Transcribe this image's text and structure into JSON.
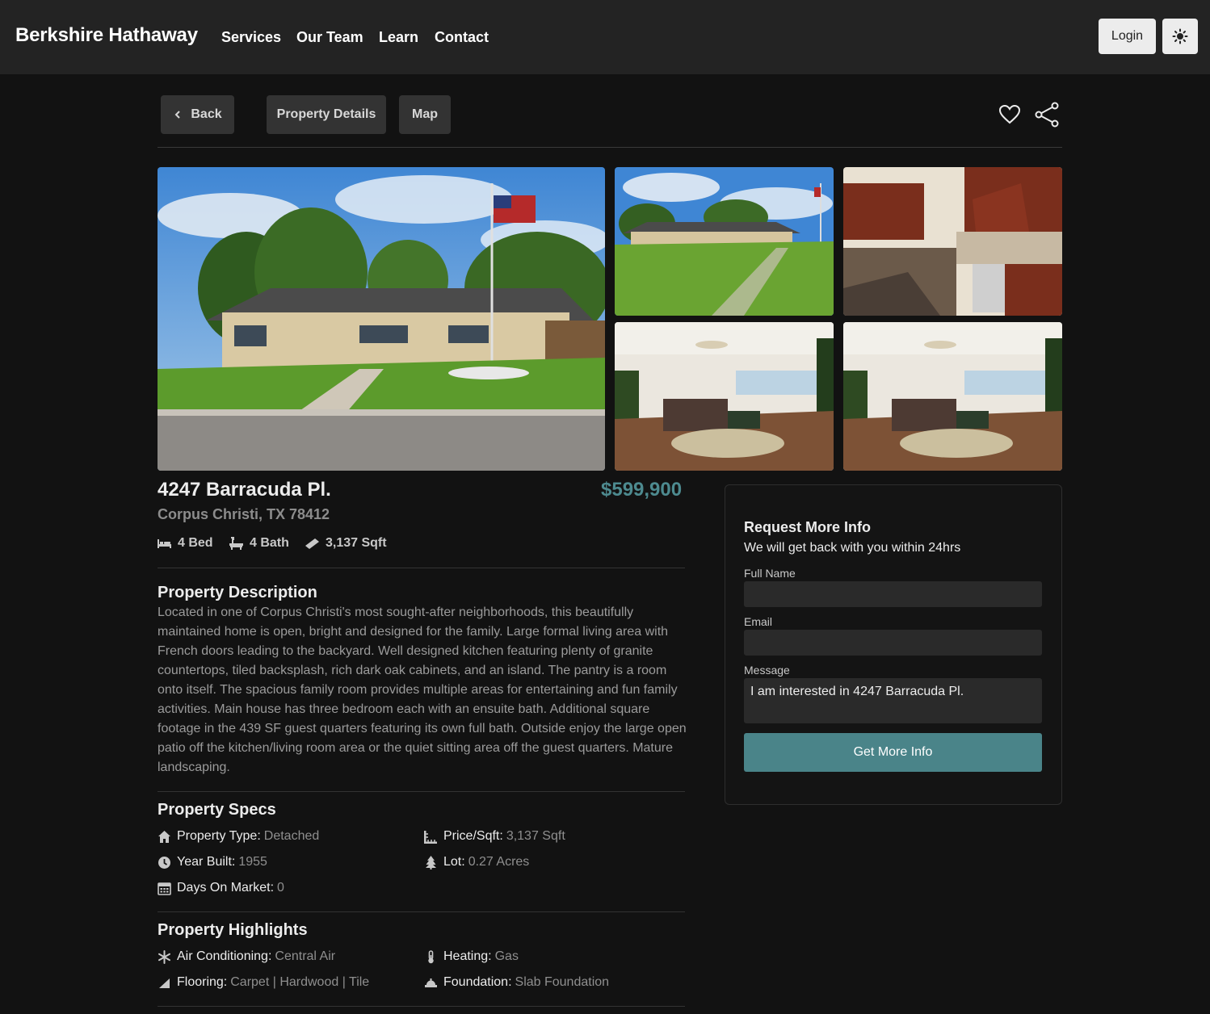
{
  "header": {
    "brand": "Berkshire Hathaway",
    "nav": [
      "Services",
      "Our Team",
      "Learn",
      "Contact"
    ],
    "login_label": "Login"
  },
  "actions": {
    "back_label": "Back",
    "details_label": "Property Details",
    "map_label": "Map"
  },
  "gallery": [
    "exterior-front",
    "exterior-lawn",
    "kitchen",
    "living-room",
    "living-room"
  ],
  "listing": {
    "address": "4247 Barracuda Pl.",
    "city": "Corpus Christi, TX 78412",
    "price": "$599,900",
    "beds": "4 Bed",
    "baths": "4 Bath",
    "sqft": "3,137 Sqft"
  },
  "description": {
    "title": "Property Description",
    "text": "Located in one of Corpus Christi's most sought-after neighborhoods, this beautifully maintained home is open, bright and designed for the family. Large formal living area with French doors leading to the backyard. Well designed kitchen featuring plenty of granite countertops, tiled backsplash, rich dark oak cabinets, and an island. The pantry is a room onto itself. The spacious family room provides multiple areas for entertaining and fun family activities. Main house has three bedroom each with an ensuite bath. Additional square footage in the 439 SF guest quarters featuring its own full bath. Outside enjoy the large open patio off the kitchen/living room area or the quiet sitting area off the guest quarters. Mature landscaping."
  },
  "specs": {
    "title": "Property Specs",
    "items": [
      {
        "label": "Property Type:",
        "value": "Detached",
        "icon": "home-icon"
      },
      {
        "label": "Price/Sqft:",
        "value": "3,137 Sqft",
        "icon": "ruler-icon"
      },
      {
        "label": "Year Built:",
        "value": "1955",
        "icon": "clock-icon"
      },
      {
        "label": "Lot:",
        "value": "0.27 Acres",
        "icon": "tree-icon"
      },
      {
        "label": "Days On Market:",
        "value": "0",
        "icon": "calendar-icon"
      }
    ]
  },
  "highlights": {
    "title": "Property Highlights",
    "items": [
      {
        "label": "Air Conditioning:",
        "value": "Central Air",
        "icon": "snowflake-icon"
      },
      {
        "label": "Heating:",
        "value": "Gas",
        "icon": "thermometer-icon"
      },
      {
        "label": "Flooring:",
        "value": "Carpet | Hardwood | Tile",
        "icon": "signal-icon"
      },
      {
        "label": "Foundation:",
        "value": "Slab Foundation",
        "icon": "foundation-icon"
      }
    ]
  },
  "form": {
    "title": "Request More Info",
    "subtitle": "We will get back with you within 24hrs",
    "name_label": "Full Name",
    "name_value": "",
    "email_label": "Email",
    "email_value": "",
    "message_label": "Message",
    "message_value": "I am interested in 4247 Barracuda Pl.",
    "submit_label": "Get More Info"
  },
  "colors": {
    "accent": "#4a8489",
    "price": "#4d8a8f",
    "background": "#121212",
    "header": "#232323"
  }
}
